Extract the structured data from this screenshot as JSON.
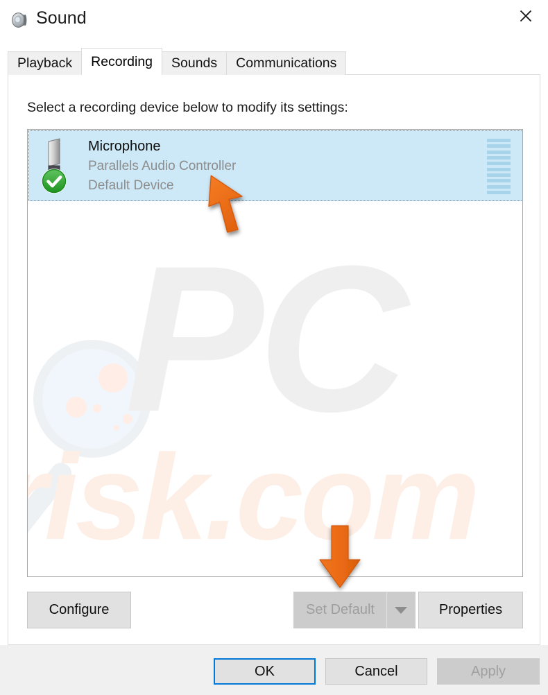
{
  "window": {
    "title": "Sound",
    "icon": "speaker-icon",
    "close_label": "✕"
  },
  "tabs": [
    {
      "label": "Playback",
      "selected": false
    },
    {
      "label": "Recording",
      "selected": true
    },
    {
      "label": "Sounds",
      "selected": false
    },
    {
      "label": "Communications",
      "selected": false
    }
  ],
  "panel": {
    "instruction": "Select a recording device below to modify its settings:"
  },
  "devices": [
    {
      "name": "Microphone",
      "description": "Parallels Audio Controller",
      "status": "Default Device",
      "icon": "microphone-icon",
      "badge": "green-check-icon",
      "selected": true,
      "meter_segments": 10
    }
  ],
  "buttons": {
    "configure": "Configure",
    "set_default": "Set Default",
    "set_default_disabled": true,
    "set_default_arrow": "chevron-down-icon",
    "properties": "Properties",
    "ok": "OK",
    "cancel": "Cancel",
    "apply": "Apply",
    "apply_disabled": true
  },
  "watermark": {
    "text_primary": "PC",
    "text_secondary": "risk.com",
    "logo": "magnifying-glass-icon"
  },
  "annotations": [
    {
      "name": "orange-cursor-arrow",
      "direction": "up-left"
    },
    {
      "name": "orange-down-arrow",
      "direction": "down"
    }
  ],
  "colors": {
    "selection": "#cde8f7",
    "meter": "#a7d4ea",
    "accent": "#0078d7",
    "annotation": "#ef6c16",
    "footer": "#f0f0f0",
    "disabled_text": "#a0a0a0"
  }
}
